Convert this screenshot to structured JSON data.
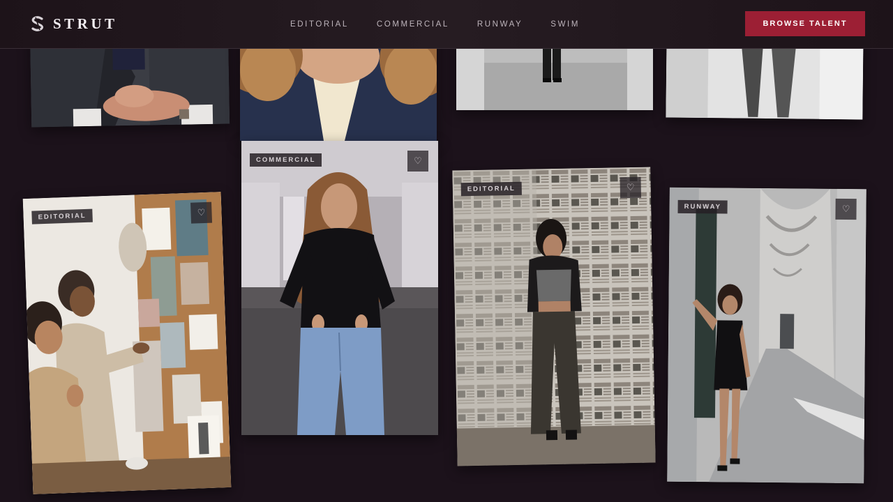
{
  "brand": {
    "name": "STRUT"
  },
  "nav": {
    "items": [
      {
        "label": "EDITORIAL"
      },
      {
        "label": "COMMERCIAL"
      },
      {
        "label": "RUNWAY"
      },
      {
        "label": "SWIM"
      }
    ]
  },
  "header": {
    "cta_label": "BROWSE TALENT"
  },
  "gallery": {
    "cards": [
      {
        "tag": "EDITORIAL",
        "fav_icon": "♡"
      },
      {
        "tag": "COMMERCIAL",
        "fav_icon": "♡"
      },
      {
        "tag": "EDITORIAL",
        "fav_icon": "♡"
      },
      {
        "tag": "RUNWAY",
        "fav_icon": "♡"
      }
    ]
  },
  "colors": {
    "background": "#1c121b",
    "accent": "#9c1f34"
  }
}
